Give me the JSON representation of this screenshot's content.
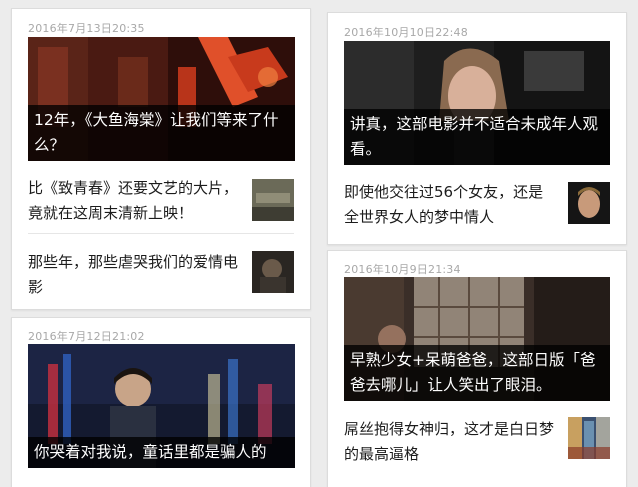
{
  "cards": [
    {
      "timestamp": "2016年7月13日20:35",
      "hero_caption": "12年，《大鱼海棠》让我们等来了什么？",
      "items": [
        {
          "title": "比《致青春》还要文艺的大片，竟就在这周末清新上映！"
        },
        {
          "title": "那些年，那些虐哭我们的爱情电影"
        }
      ]
    },
    {
      "timestamp": "2016年7月12日21:02",
      "hero_caption": "你哭着对我说，童话里都是骗人的"
    },
    {
      "timestamp": "2016年10月10日22:48",
      "hero_caption": "讲真，这部电影并不适合未成年人观看。",
      "items": [
        {
          "title": "即使他交往过56个女友，还是全世界女人的梦中情人"
        }
      ]
    },
    {
      "timestamp": "2016年10月9日21:34",
      "hero_caption": "早熟少女+呆萌爸爸，这部日版「爸爸去哪儿」让人笑出了眼泪。",
      "items": [
        {
          "title": "屌丝抱得女神归，这才是白日梦的最高逼格"
        }
      ]
    }
  ]
}
